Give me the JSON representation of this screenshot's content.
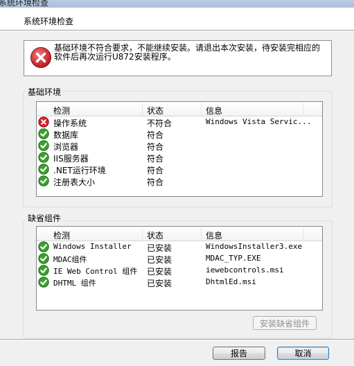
{
  "window": {
    "title": "系统环境检查"
  },
  "header": {
    "heading": "系统环境检查"
  },
  "warning": {
    "message": "基础环境不符合要求，不能继续安装。请退出本次安装，待安装完相应的软件后再次运行U872安装程序。"
  },
  "basic_env": {
    "label": "基础环境",
    "columns": [
      "检测",
      "状态",
      "信息"
    ],
    "rows": [
      {
        "icon": "error-icon",
        "name": "操作系统",
        "status": "不符合",
        "info": "Windows Vista Servic..."
      },
      {
        "icon": "success-icon",
        "name": "数据库",
        "status": "符合",
        "info": ""
      },
      {
        "icon": "success-icon",
        "name": "浏览器",
        "status": "符合",
        "info": ""
      },
      {
        "icon": "success-icon",
        "name": "IIS服务器",
        "status": "符合",
        "info": ""
      },
      {
        "icon": "success-icon",
        "name": ".NET运行环境",
        "status": "符合",
        "info": ""
      },
      {
        "icon": "success-icon",
        "name": "注册表大小",
        "status": "符合",
        "info": ""
      }
    ]
  },
  "missing_components": {
    "label": "缺省组件",
    "columns": [
      "检测",
      "状态",
      "信息"
    ],
    "rows": [
      {
        "icon": "success-icon",
        "name": "Windows Installer",
        "status": "已安装",
        "info": "WindowsInstaller3.exe"
      },
      {
        "icon": "success-icon",
        "name": "MDAC组件",
        "status": "已安装",
        "info": "MDAC_TYP.EXE"
      },
      {
        "icon": "success-icon",
        "name": "IE Web Control 组件",
        "status": "已安装",
        "info": "iewebcontrols.msi"
      },
      {
        "icon": "success-icon",
        "name": "DHTML 组件",
        "status": "已安装",
        "info": "DhtmlEd.msi"
      }
    ],
    "install_button": "安装缺省组件"
  },
  "footer": {
    "report_button": "报告",
    "cancel_button": "取消"
  },
  "colors": {
    "error": "#d9232b",
    "success": "#3ca12d"
  }
}
